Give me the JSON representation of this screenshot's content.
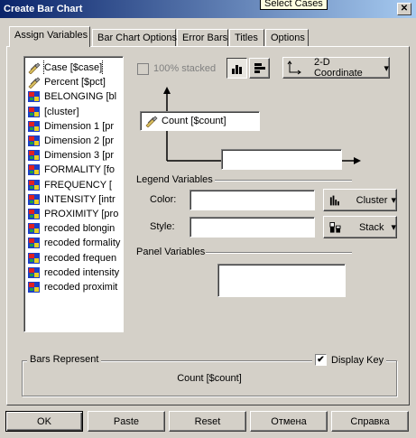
{
  "window": {
    "title": "Create Bar Chart",
    "tooltip": "Select Cases",
    "close_glyph": "✕"
  },
  "tabs": [
    {
      "label": "Assign Variables",
      "active": true
    },
    {
      "label": "Bar Chart Options"
    },
    {
      "label": "Error Bars"
    },
    {
      "label": "Titles"
    },
    {
      "label": "Options"
    }
  ],
  "variables": [
    {
      "label": "Case [$case]",
      "icon": "pencil-icon",
      "selected": true
    },
    {
      "label": "Percent [$pct]",
      "icon": "pencil-icon"
    },
    {
      "label": "BELONGING [bl",
      "icon": "nominal-icon"
    },
    {
      "label": "[cluster]",
      "icon": "nominal-icon"
    },
    {
      "label": "Dimension 1  [pr",
      "icon": "nominal-icon"
    },
    {
      "label": "Dimension 2  [pr",
      "icon": "nominal-icon"
    },
    {
      "label": "Dimension 3  [pr",
      "icon": "nominal-icon"
    },
    {
      "label": "FORMALITY [fo",
      "icon": "nominal-icon"
    },
    {
      "label": "FREQUENCY  [",
      "icon": "nominal-icon"
    },
    {
      "label": "INTENSITY [intr",
      "icon": "nominal-icon"
    },
    {
      "label": "PROXIMITY [pro",
      "icon": "nominal-icon"
    },
    {
      "label": "recoded blongin",
      "icon": "nominal-icon"
    },
    {
      "label": "recoded formality",
      "icon": "nominal-icon"
    },
    {
      "label": "recoded frequen",
      "icon": "nominal-icon"
    },
    {
      "label": "recoded intensity",
      "icon": "nominal-icon"
    },
    {
      "label": "recoded proximit",
      "icon": "nominal-icon"
    }
  ],
  "options": {
    "stacked_label": "100% stacked",
    "stacked_checked": false,
    "coordinate_label": "2-D Coordinate",
    "dropdown_glyph": "▾"
  },
  "axes": {
    "y_variable": "Count [$count]",
    "x_variable": ""
  },
  "legend": {
    "header": "Legend Variables",
    "color_label": "Color:",
    "color_value": "",
    "color_mode": "Cluster",
    "style_label": "Style:",
    "style_value": "",
    "style_mode": "Stack"
  },
  "panel_variables": {
    "header": "Panel Variables",
    "value": ""
  },
  "bars_represent": {
    "header": "Bars Represent",
    "value": "Count [$count]",
    "display_key_label": "Display Key",
    "display_key_checked": true,
    "check_glyph": "✔"
  },
  "buttons": {
    "ok": "OK",
    "paste": "Paste",
    "reset": "Reset",
    "cancel": "Отмена",
    "help": "Справка"
  }
}
